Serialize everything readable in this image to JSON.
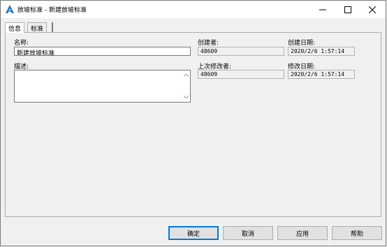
{
  "window": {
    "title": "放坡标准 - 新建放坡标准",
    "icons": {
      "app": "autodesk-a-icon",
      "minimize": "minimize-icon",
      "maximize": "maximize-icon",
      "close": "close-icon"
    }
  },
  "tabs": [
    {
      "label": "信息",
      "active": true
    },
    {
      "label": "标准",
      "active": false
    }
  ],
  "info": {
    "name_label": "名称:",
    "name_value": "新建放坡标准",
    "description_label": "描述:",
    "description_value": "",
    "created_by_label": "创建者:",
    "created_by_value": "48609",
    "created_date_label": "创建日期:",
    "created_date_value": "2020/2/6 1:57:14",
    "modified_by_label": "上次修改者:",
    "modified_by_value": "48609",
    "modified_date_label": "修改日期:",
    "modified_date_value": "2020/2/6 1:57:14"
  },
  "buttons": {
    "ok": "确定",
    "cancel": "取消",
    "apply": "应用",
    "help": "帮助"
  },
  "colors": {
    "accent": "#0078d7",
    "app_icon": "#1f6fb5"
  }
}
